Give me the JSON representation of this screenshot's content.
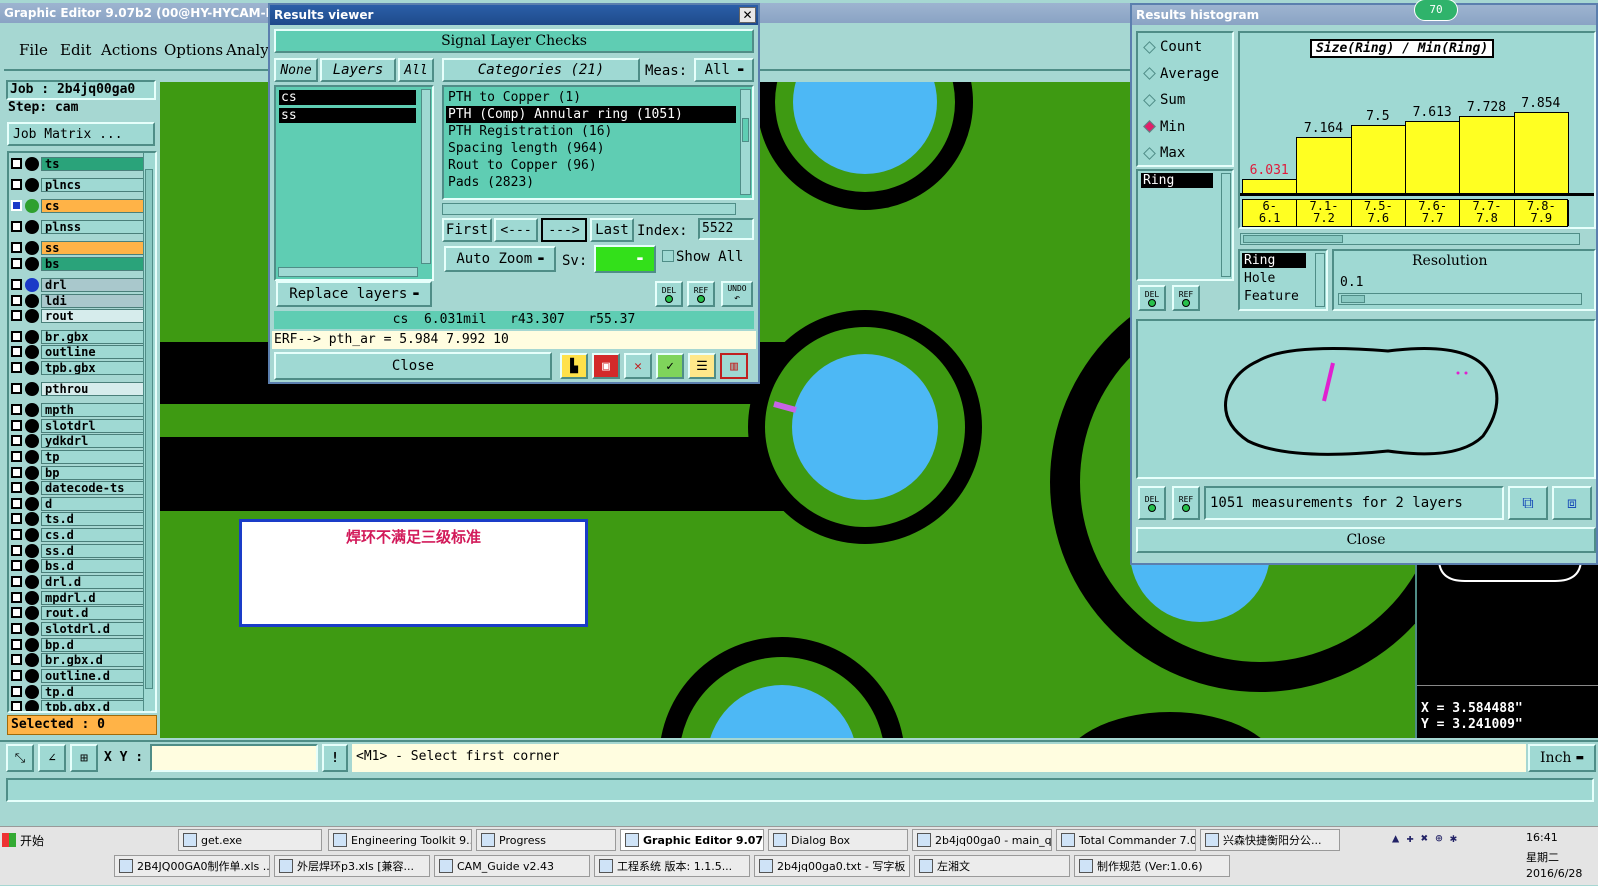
{
  "main_window": {
    "title": "Graphic Editor 9.07b2 (00@HY-HYCAM-PC17",
    "menu": [
      "File",
      "Edit",
      "Actions",
      "Options",
      "Analys"
    ]
  },
  "left_panel": {
    "job": "Job : 2b4jq00ga0",
    "step": "Step: cam",
    "job_matrix": "Job Matrix ...",
    "selected": "Selected : 0",
    "layers": [
      {
        "name": "ts",
        "color": "#2aa37a"
      },
      {
        "name": "plncs",
        "color": "#9fd9d3"
      },
      {
        "name": "cs",
        "color": "#ffb347"
      },
      {
        "name": "plnss",
        "color": "#9fd9d3"
      },
      {
        "name": "ss",
        "color": "#ffb347"
      },
      {
        "name": "bs",
        "color": "#2aa37a"
      },
      {
        "name": "drl",
        "color": "#a9c8cc"
      },
      {
        "name": "ldi",
        "color": "#a9c8cc"
      },
      {
        "name": "rout",
        "color": "#d6ecec"
      },
      {
        "name": "br.gbx",
        "color": "#9fd9d3"
      },
      {
        "name": "outline",
        "color": "#9fd9d3"
      },
      {
        "name": "tpb.gbx",
        "color": "#9fd9d3"
      },
      {
        "name": "pthrou",
        "color": "#d6ecec"
      },
      {
        "name": "mpth",
        "color": "#9fd9d3"
      },
      {
        "name": "slotdrl",
        "color": "#9fd9d3"
      },
      {
        "name": "ydkdrl",
        "color": "#9fd9d3"
      },
      {
        "name": "tp",
        "color": "#9fd9d3"
      },
      {
        "name": "bp",
        "color": "#9fd9d3"
      },
      {
        "name": "datecode-ts",
        "color": "#9fd9d3"
      },
      {
        "name": "d",
        "color": "#9fd9d3"
      },
      {
        "name": "ts.d",
        "color": "#9fd9d3"
      },
      {
        "name": "cs.d",
        "color": "#9fd9d3"
      },
      {
        "name": "ss.d",
        "color": "#9fd9d3"
      },
      {
        "name": "bs.d",
        "color": "#9fd9d3"
      },
      {
        "name": "drl.d",
        "color": "#9fd9d3"
      },
      {
        "name": "mpdrl.d",
        "color": "#9fd9d3"
      },
      {
        "name": "rout.d",
        "color": "#9fd9d3"
      },
      {
        "name": "slotdrl.d",
        "color": "#9fd9d3"
      },
      {
        "name": "bp.d",
        "color": "#9fd9d3"
      },
      {
        "name": "br.gbx.d",
        "color": "#9fd9d3"
      },
      {
        "name": "outline.d",
        "color": "#9fd9d3"
      },
      {
        "name": "tp.d",
        "color": "#9fd9d3"
      },
      {
        "name": "tpb.gbx.d",
        "color": "#9fd9d3"
      }
    ]
  },
  "results_viewer": {
    "title": "Results viewer",
    "header": "Signal Layer Checks",
    "none": "None",
    "layers_label": "Layers",
    "all": "All",
    "layer_list": [
      "cs",
      "ss"
    ],
    "categories_label": "Categories (21)",
    "meas_label": "Meas:",
    "meas_value": "All",
    "categories": [
      "PTH to Copper (1)",
      "PTH (Comp) Annular ring (1051)",
      "PTH Registration (16)",
      "Spacing length (964)",
      "Rout to Copper (96)",
      "Pads (2823)"
    ],
    "first": "First",
    "prev": "<---",
    "next": "--->",
    "last": "Last",
    "index_label": "Index:",
    "index_value": "5522",
    "auto_zoom": "Auto Zoom",
    "sv_label": "Sv:",
    "show_all": "Show All",
    "replace_layers": "Replace layers",
    "del": "DEL",
    "ref": "REF",
    "undo": "UNDO",
    "status": "cs  6.031mil   r43.307   r55.37",
    "erf": "ERF--> pth_ar = 5.984 7.992 10",
    "close": "Close"
  },
  "histogram": {
    "title": "Results histogram",
    "stats": [
      "Count",
      "Average",
      "Sum",
      "Min",
      "Max"
    ],
    "selected_stat": "Min",
    "chart_title": "Size(Ring) / Min(Ring)",
    "list_item": "Ring",
    "bin_values": [
      "6.031",
      "7.164",
      "7.5",
      "7.613",
      "7.728",
      "7.854"
    ],
    "bins": [
      "6-\n6.1",
      "7.1-\n7.2",
      "7.5-\n7.6",
      "7.6-\n7.7",
      "7.7-\n7.8",
      "7.8-\n7.9"
    ],
    "res_list": [
      "Ring",
      "Hole",
      "Feature"
    ],
    "resolution_label": "Resolution",
    "resolution_value": "0.1",
    "summary": "1051 measurements for 2 layers",
    "close": "Close",
    "badge": "70"
  },
  "chart_data": {
    "type": "bar",
    "title": "Size(Ring) / Min(Ring)",
    "categories": [
      "6-6.1",
      "7.1-7.2",
      "7.5-7.6",
      "7.6-7.7",
      "7.7-7.8",
      "7.8-7.9"
    ],
    "values": [
      6.031,
      7.164,
      7.5,
      7.613,
      7.728,
      7.854
    ]
  },
  "canvas": {
    "annotation": "焊环不满足三级标准",
    "coord_x": "X = 3.584488\"",
    "coord_y": "Y = 3.241009\""
  },
  "bottom": {
    "xy_label": "X Y :",
    "prompt": "<M1> - Select first corner",
    "units": "Inch"
  },
  "taskbar": {
    "start": "开始",
    "row1": [
      "get.exe",
      "Engineering Toolkit 9....",
      "Progress",
      "Graphic Editor 9.07...",
      "Dialog Box",
      "2b4jq00ga0 - main_qa",
      "Total Commander 7.0 ...",
      "兴森快捷衡阳分公..."
    ],
    "row2": [
      "2B4JQ00GA0制作单.xls ...",
      "外层焊环p3.xls [兼容...",
      "CAM_Guide v2.43",
      "工程系统  版本: 1.1.5...",
      "2b4jq00ga0.txt - 写字板",
      "左湘文",
      "制作规范 (Ver:1.0.6)"
    ],
    "time": "16:41",
    "weekday": "星期二",
    "date": "2016/6/28"
  }
}
